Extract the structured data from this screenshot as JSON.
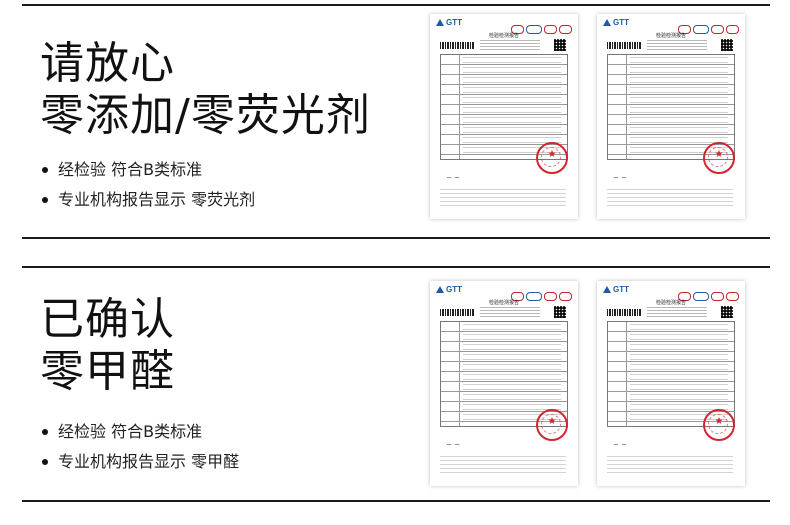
{
  "sections": [
    {
      "title_line1": "请放心",
      "title_line2": "零添加/零荧光剂",
      "bullets": [
        "经检验 符合B类标准",
        "专业机构报告显示 零荧光剂"
      ],
      "reports": [
        {
          "logo": "GTT",
          "title": "检验检测报告"
        },
        {
          "logo": "GTT",
          "title": "检验检测报告"
        }
      ]
    },
    {
      "title_line1": "已确认",
      "title_line2": "零甲醛",
      "bullets": [
        "经检验 符合B类标准",
        "专业机构报告显示 零甲醛"
      ],
      "reports": [
        {
          "logo": "GTT",
          "title": "检验检测报告"
        },
        {
          "logo": "GTT",
          "title": "检验检测报告"
        }
      ]
    }
  ],
  "colors": {
    "rule": "#1a1a1a",
    "stamp": "#d2262f",
    "logo": "#1e5aa8"
  },
  "icons": [
    "bullet-dot-icon",
    "gtt-logo-icon",
    "barcode-icon",
    "qr-code-icon",
    "red-seal-stamp-icon"
  ]
}
